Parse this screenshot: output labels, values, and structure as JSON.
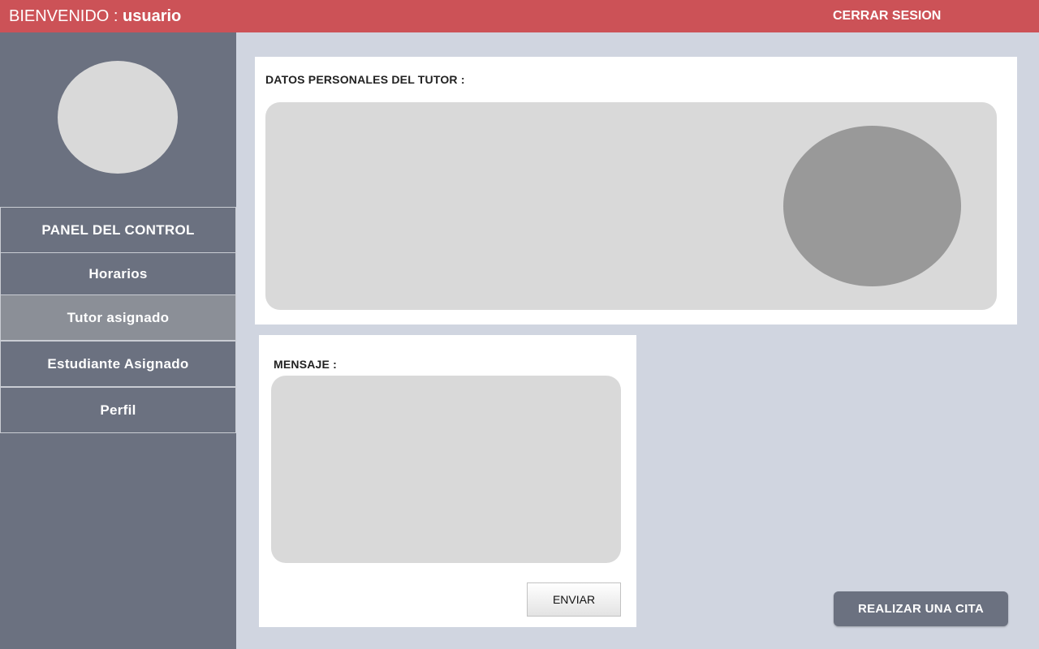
{
  "header": {
    "welcome_label": "BIENVENIDO : ",
    "username": "usuario",
    "logout_label": "CERRAR SESION"
  },
  "sidebar": {
    "items": [
      {
        "label": "PANEL DEL CONTROL"
      },
      {
        "label": "Horarios"
      },
      {
        "label": "Tutor asignado"
      },
      {
        "label": "Estudiante Asignado"
      },
      {
        "label": "Perfil"
      }
    ],
    "active_item": "Tutor asignado"
  },
  "tutor_section": {
    "title": "DATOS PERSONALES DEL TUTOR :"
  },
  "message_section": {
    "title": "MENSAJE :",
    "message_value": "",
    "send_label": "ENVIAR"
  },
  "appointment_button": {
    "label": "REALIZAR UNA CITA"
  },
  "colors": {
    "header_bg": "#cc5257",
    "sidebar_bg": "#6b7180",
    "sidebar_active_bg": "#8b8f97",
    "content_bg": "#d0d5e0",
    "placeholder_gray": "#d9d9d9",
    "photo_gray": "#999999"
  }
}
